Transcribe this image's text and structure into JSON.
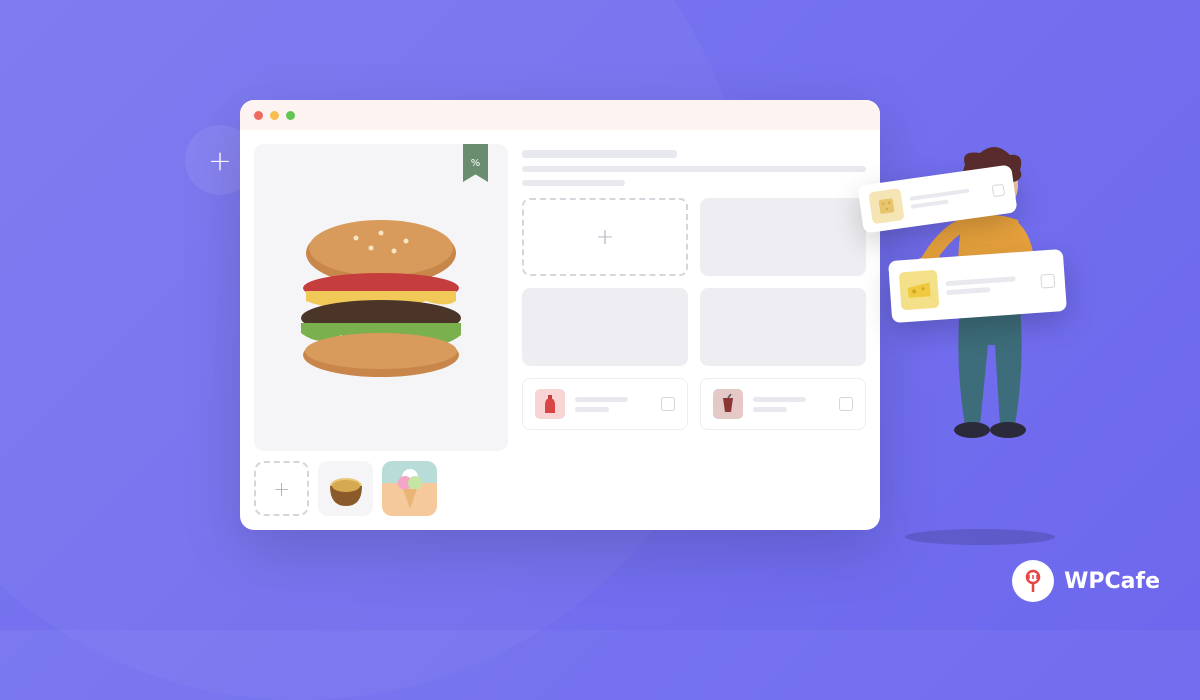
{
  "badge": {
    "symbol": "+"
  },
  "hero": {
    "discount_icon": "%",
    "alt": "burger"
  },
  "thumbs": {
    "add_symbol": "+",
    "item1": "chips-bowl",
    "item2": "ice-cream"
  },
  "slots": {
    "add_symbol": "+"
  },
  "list_items": [
    {
      "icon": "bottle",
      "color": "red"
    },
    {
      "icon": "drink",
      "color": "dark"
    }
  ],
  "float_cards": [
    {
      "icon": "crackers"
    },
    {
      "icon": "cheese"
    }
  ],
  "brand": {
    "name": "WPCafe"
  }
}
